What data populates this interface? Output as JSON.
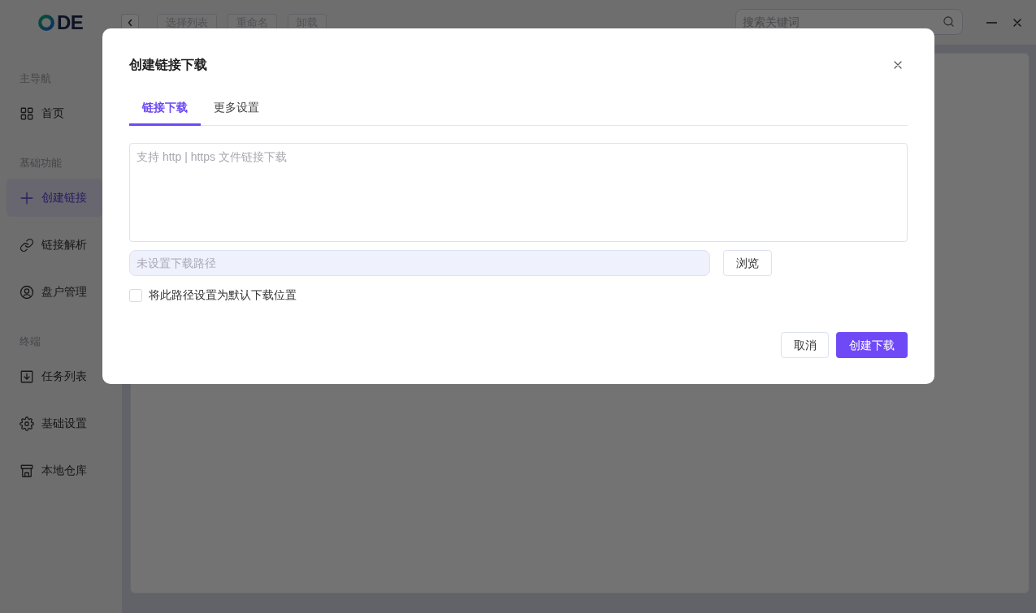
{
  "header": {
    "logo_text": "DE",
    "toolbar_buttons": [
      {
        "label": "选择列表",
        "disabled": true
      },
      {
        "label": "重命名",
        "disabled": true
      },
      {
        "label": "卸载",
        "disabled": true
      }
    ],
    "search": {
      "placeholder": "搜索关键词"
    }
  },
  "sidebar": {
    "sections": [
      {
        "title": "主导航",
        "items": [
          {
            "label": "首页",
            "selected": false
          }
        ]
      },
      {
        "title": "基础功能",
        "items": [
          {
            "label": "创建链接",
            "selected": true
          },
          {
            "label": "链接解析",
            "selected": false
          },
          {
            "label": "盘户管理",
            "selected": false
          }
        ]
      },
      {
        "title": "终端",
        "items": [
          {
            "label": "任务列表",
            "selected": false
          },
          {
            "label": "基础设置",
            "selected": false
          },
          {
            "label": "本地仓库",
            "selected": false
          }
        ]
      }
    ]
  },
  "dialog": {
    "title": "创建链接下载",
    "tabs": [
      {
        "label": "链接下载",
        "selected": true
      },
      {
        "label": "更多设置",
        "selected": false
      }
    ],
    "url_field": {
      "placeholder": "支持 http | https 文件链接下载"
    },
    "path_field": {
      "placeholder": "未设置下载路径"
    },
    "browse_button": "浏览",
    "default_checkbox": {
      "label": "将此路径设置为默认下载位置",
      "checked": false
    },
    "buttons": [
      {
        "label": "取消",
        "kind": "secondary"
      },
      {
        "label": "创建下载",
        "kind": "primary"
      }
    ]
  }
}
